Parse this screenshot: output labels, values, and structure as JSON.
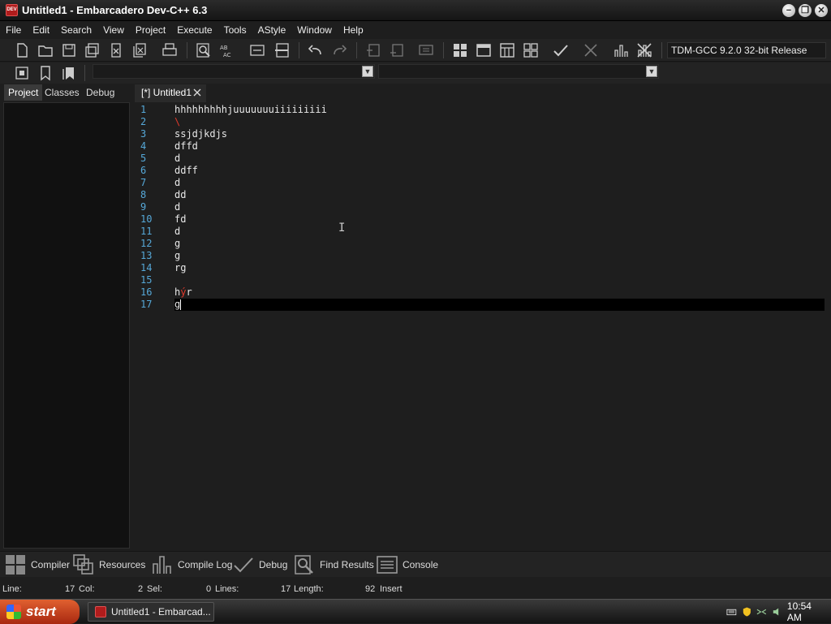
{
  "window": {
    "title": "Untitled1 - Embarcadero Dev-C++ 6.3",
    "app_icon_text": "DEV",
    "minimize": "−",
    "restore": "❐",
    "close": "✕"
  },
  "menu": [
    "File",
    "Edit",
    "Search",
    "View",
    "Project",
    "Execute",
    "Tools",
    "AStyle",
    "Window",
    "Help"
  ],
  "toolbar": {
    "compiler": "TDM-GCC 9.2.0 32-bit Release",
    "icons": [
      "new-file-icon",
      "open-icon",
      "save-icon",
      "save-all-icon",
      "close-icon",
      "close-all-icon",
      "print-icon",
      "find-icon",
      "replace-icon",
      "goto-line-icon",
      "compile-run-icon",
      "undo-icon",
      "redo-icon",
      "indent-icon",
      "unindent-icon",
      "toggle-comment-icon",
      "compile-icon",
      "run-icon",
      "compile-and-run-icon",
      "rebuild-icon",
      "syntax-check-icon",
      "stop-icon",
      "profile-icon",
      "delete-profile-icon"
    ]
  },
  "left_panel": {
    "tabs": [
      "Project",
      "Classes",
      "Debug"
    ],
    "active": "Project"
  },
  "editor": {
    "tab_label": "[*] Untitled1",
    "lines": [
      "hhhhhhhhhjuuuuuuuiiiiiiiii",
      "\\",
      "ssjdjkdjs",
      "dffd",
      "d",
      "ddff",
      "d",
      "dd",
      "d",
      "fd",
      "d",
      "g",
      "g",
      "rg",
      "",
      "hýr",
      "g"
    ],
    "line16": {
      "a": "h",
      "b": "ý",
      "c": "r"
    },
    "current_line": 17
  },
  "bottom_tabs": [
    "Compiler",
    "Resources",
    "Compile Log",
    "Debug",
    "Find Results",
    "Console"
  ],
  "status": {
    "line": "Line:",
    "line_val": "17",
    "col": "Col:",
    "col_val": "2",
    "sel": "Sel:",
    "sel_val": "0",
    "lines": "Lines:",
    "lines_val": "17",
    "length": "Length:",
    "length_val": "92",
    "mode": "Insert"
  },
  "taskbar": {
    "start": "start",
    "task": "Untitled1 - Embarcad...",
    "time": "10:54 AM"
  }
}
